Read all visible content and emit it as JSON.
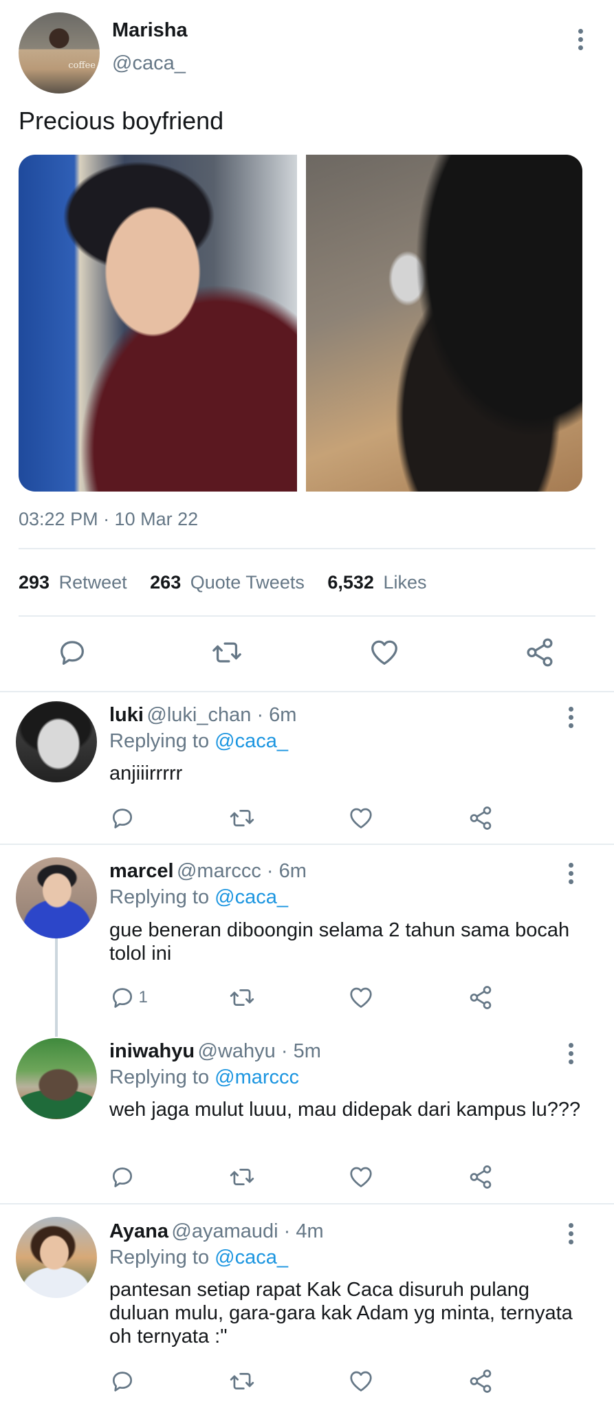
{
  "tweet": {
    "name": "Marisha",
    "handle": "@caca_",
    "avatar_text": "coffee",
    "text": "Precious boyfriend",
    "timestamp": "03:22 PM · 10 Mar 22",
    "stats": {
      "retweets_count": "293",
      "retweets_label": "Retweet",
      "quotes_count": "263",
      "quotes_label": "Quote Tweets",
      "likes_count": "6,532",
      "likes_label": "Likes"
    }
  },
  "replies": [
    {
      "name": "luki",
      "meta": "@luki_chan · 6m",
      "replying_label": "Replying to",
      "replying_to": "@caca_",
      "text": "anjiiirrrrr",
      "reply_count": ""
    },
    {
      "name": "marcel",
      "meta": "@marccc · 6m",
      "replying_label": "Replying to",
      "replying_to": "@caca_",
      "text": "gue beneran diboongin selama 2 tahun sama bocah tolol ini",
      "reply_count": "1"
    },
    {
      "name": "iniwahyu",
      "meta": "@wahyu · 5m",
      "replying_label": "Replying to",
      "replying_to": "@marccc",
      "text": "weh jaga mulut luuu, mau didepak dari kampus lu???",
      "reply_count": ""
    },
    {
      "name": "Ayana",
      "meta": "@ayamaudi · 4m",
      "replying_label": "Replying to",
      "replying_to": "@caca_",
      "text": "pantesan setiap rapat Kak Caca disuruh pulang duluan mulu, gara-gara kak Adam yg minta, ternyata oh ternyata :\"",
      "reply_count": ""
    }
  ],
  "colors": {
    "text": "#14171a",
    "secondary": "#657786",
    "link": "#1b95e0",
    "divider": "#e6ecf0"
  },
  "icons": [
    "more-icon",
    "reply-icon",
    "retweet-icon",
    "like-icon",
    "share-icon"
  ]
}
